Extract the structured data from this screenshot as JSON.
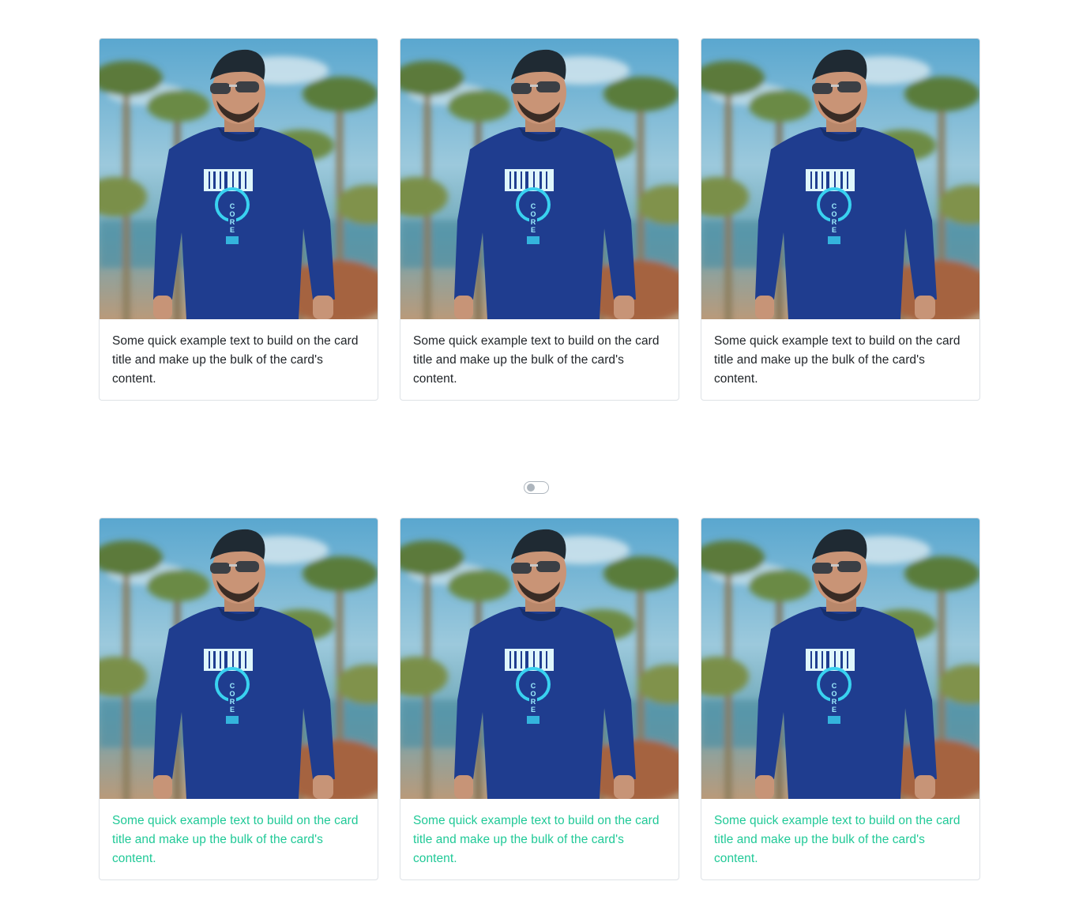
{
  "cards_top": [
    {
      "text": "Some quick example text to build on the card title and make up the bulk of the card's content."
    },
    {
      "text": "Some quick example text to build on the card title and make up the bulk of the card's content."
    },
    {
      "text": "Some quick example text to build on the card title and make up the bulk of the card's content."
    }
  ],
  "cards_bottom": [
    {
      "text": "Some quick example text to build on the card title and make up the bulk of the card's content."
    },
    {
      "text": "Some quick example text to build on the card title and make up the bulk of the card's content."
    },
    {
      "text": "Some quick example text to build on the card title and make up the bulk of the card's content."
    }
  ],
  "toggle": {
    "checked": false
  },
  "colors": {
    "bottom_text": "#20c997",
    "top_text": "#212529",
    "shirt": "#1f3d8f",
    "sky": "#7fbcd6"
  },
  "image_icon": "person-portrait-palm-trees"
}
